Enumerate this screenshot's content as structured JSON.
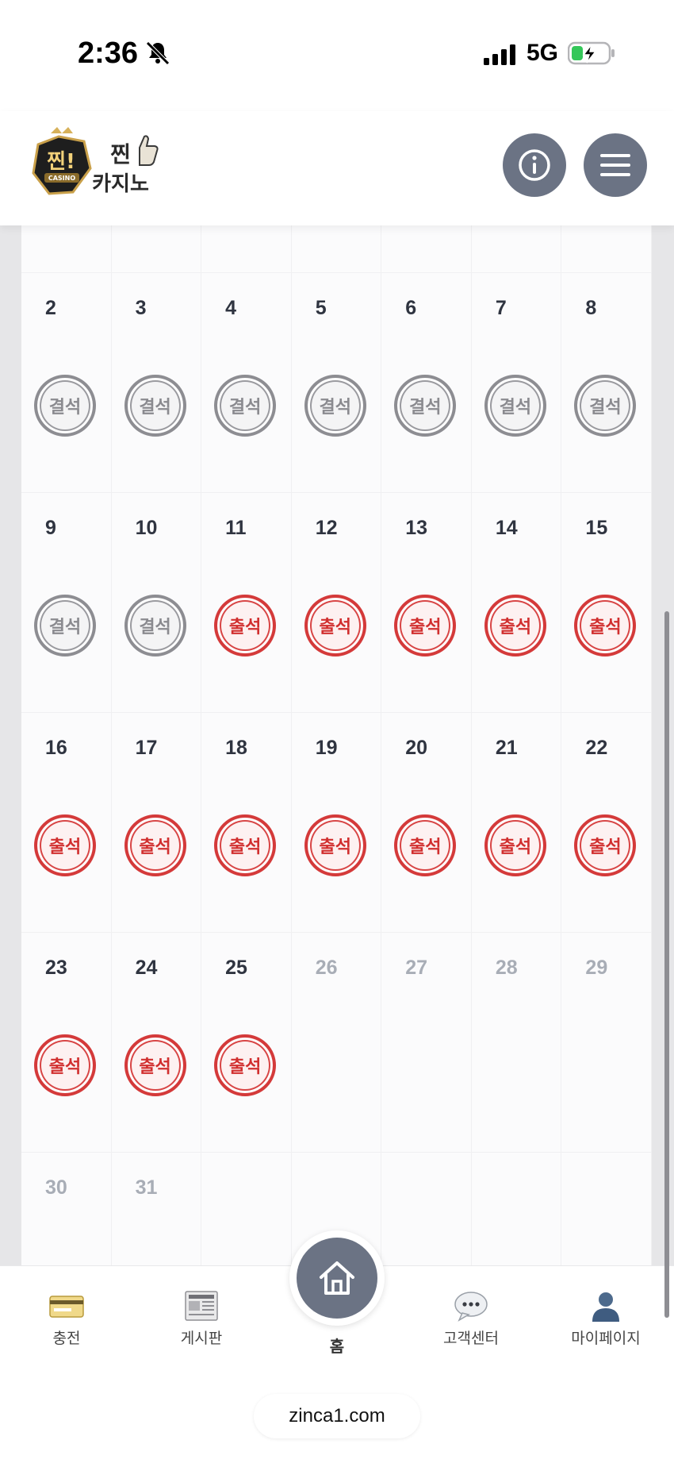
{
  "status_bar": {
    "time": "2:36",
    "network": "5G"
  },
  "header": {
    "logo_text_top": "찐!",
    "logo_text_bottom": "카지노",
    "logo_badge": "CASINO"
  },
  "calendar": {
    "rows": [
      [
        {
          "day": "2",
          "stamp": "결석"
        },
        {
          "day": "3",
          "stamp": "결석"
        },
        {
          "day": "4",
          "stamp": "결석"
        },
        {
          "day": "5",
          "stamp": "결석"
        },
        {
          "day": "6",
          "stamp": "결석"
        },
        {
          "day": "7",
          "stamp": "결석"
        },
        {
          "day": "8",
          "stamp": "결석"
        }
      ],
      [
        {
          "day": "9",
          "stamp": "결석"
        },
        {
          "day": "10",
          "stamp": "결석"
        },
        {
          "day": "11",
          "stamp": "출석"
        },
        {
          "day": "12",
          "stamp": "출석"
        },
        {
          "day": "13",
          "stamp": "출석"
        },
        {
          "day": "14",
          "stamp": "출석"
        },
        {
          "day": "15",
          "stamp": "출석"
        }
      ],
      [
        {
          "day": "16",
          "stamp": "출석"
        },
        {
          "day": "17",
          "stamp": "출석"
        },
        {
          "day": "18",
          "stamp": "출석"
        },
        {
          "day": "19",
          "stamp": "출석"
        },
        {
          "day": "20",
          "stamp": "출석"
        },
        {
          "day": "21",
          "stamp": "출석"
        },
        {
          "day": "22",
          "stamp": "출석"
        }
      ],
      [
        {
          "day": "23",
          "stamp": "출석"
        },
        {
          "day": "24",
          "stamp": "출석"
        },
        {
          "day": "25",
          "stamp": "출석"
        },
        {
          "day": "26",
          "stamp": ""
        },
        {
          "day": "27",
          "stamp": ""
        },
        {
          "day": "28",
          "stamp": ""
        },
        {
          "day": "29",
          "stamp": ""
        }
      ],
      [
        {
          "day": "30",
          "stamp": ""
        },
        {
          "day": "31",
          "stamp": ""
        }
      ]
    ]
  },
  "colors": {
    "present": "#d43a3a",
    "absent": "#8d8d92",
    "button": "#6b7384"
  },
  "bottom_nav": {
    "items": [
      {
        "label": "충전",
        "icon": "credit-card-icon"
      },
      {
        "label": "게시판",
        "icon": "newspaper-icon"
      },
      {
        "label": "고객센터",
        "icon": "chat-bubble-icon"
      },
      {
        "label": "마이페이지",
        "icon": "user-icon"
      }
    ],
    "home_label": "홈"
  },
  "browser": {
    "url": "zinca1.com"
  }
}
